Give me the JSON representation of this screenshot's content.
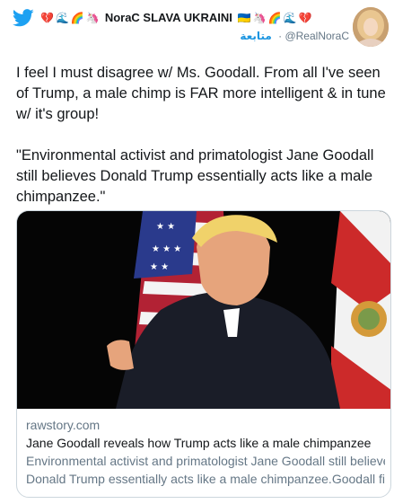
{
  "header": {
    "bird_icon": "twitter-bird-icon",
    "display_name": "NoraC SLAVA UKRAINI",
    "emoji_left": [
      "💔",
      "🌊",
      "🌈",
      "🦄"
    ],
    "emoji_right": [
      "🇺🇦",
      "🦄",
      "🌈",
      "🌊",
      "💔"
    ],
    "handle": "@RealNoraC",
    "separator": "·",
    "follow_label": "متابعة",
    "colors": {
      "brand": "#1da1f2",
      "follow": "#1b95e0"
    }
  },
  "tweet": {
    "paragraph_1": "I feel I must disagree w/ Ms. Goodall. From all I've seen of Trump, a male chimp is FAR more intelligent & in tune w/ it's group!",
    "paragraph_2": "\"Environmental activist and primatologist Jane Goodall still believes Donald Trump essentially acts like a male chimpanzee.\""
  },
  "card": {
    "domain": "rawstory.com",
    "title": "Jane Goodall reveals how Trump acts like a male chimpanzee",
    "description_line_1": "Environmental activist and primatologist Jane Goodall still believes",
    "description_line_2": "Donald Trump essentially acts like a male chimpanzee.Goodall fir..."
  }
}
